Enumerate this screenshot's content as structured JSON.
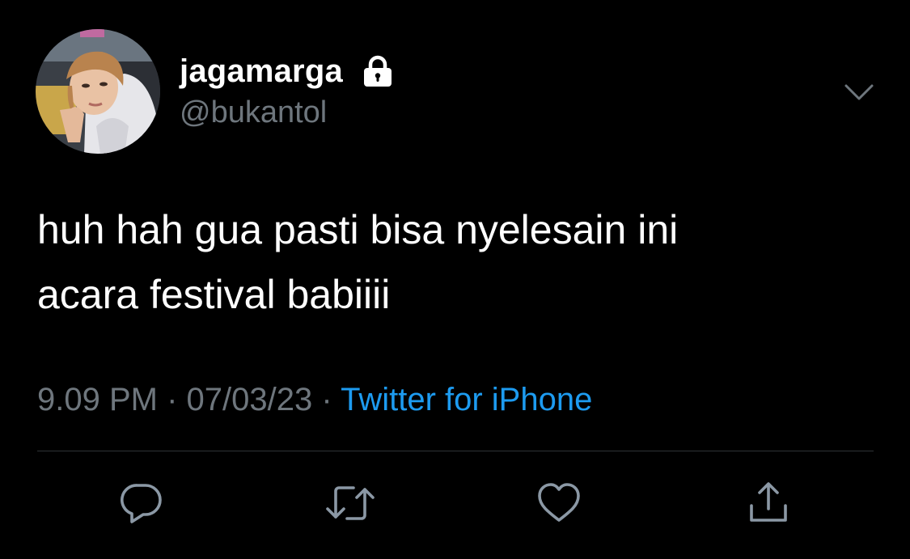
{
  "tweet": {
    "author": {
      "display_name": "jagamarga",
      "handle": "@bukantol",
      "protected_icon": "lock-icon",
      "avatar": "avatar"
    },
    "text_lines": [
      "huh hah gua pasti bisa nyelesain ini",
      "acara festival babiiii"
    ],
    "time": "9.09 PM",
    "separator": "·",
    "date": "07/03/23",
    "source": "Twitter for iPhone",
    "more_icon": "chevron-down-icon"
  },
  "actions": [
    {
      "icon": "reply-icon"
    },
    {
      "icon": "retweet-icon"
    },
    {
      "icon": "like-icon"
    },
    {
      "icon": "share-icon"
    }
  ],
  "colors": {
    "background": "#000000",
    "primary_text": "#ffffff",
    "secondary_text": "#6e767d",
    "accent": "#1d9bf0",
    "divider": "#2f3336"
  }
}
